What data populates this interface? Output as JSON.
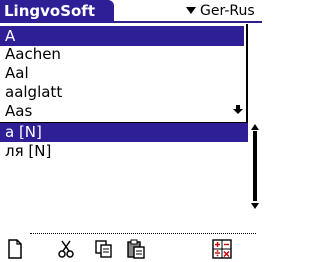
{
  "app": {
    "title": "LingvoSoft"
  },
  "language_selector": {
    "value": "Ger-Rus"
  },
  "search": {
    "value": "A"
  },
  "word_list": {
    "items": [
      "Aachen",
      "Aal",
      "aalglatt",
      "Aas"
    ]
  },
  "translations": {
    "items": [
      "а [N]",
      "ля [N]"
    ]
  },
  "toolbar": {
    "icons": [
      "new-page-icon",
      "cut-icon",
      "copy-icon",
      "paste-icon",
      "calculator-icon"
    ]
  },
  "colors": {
    "accent": "#2e1f97",
    "background": "#ffffff",
    "text": "#000000"
  }
}
